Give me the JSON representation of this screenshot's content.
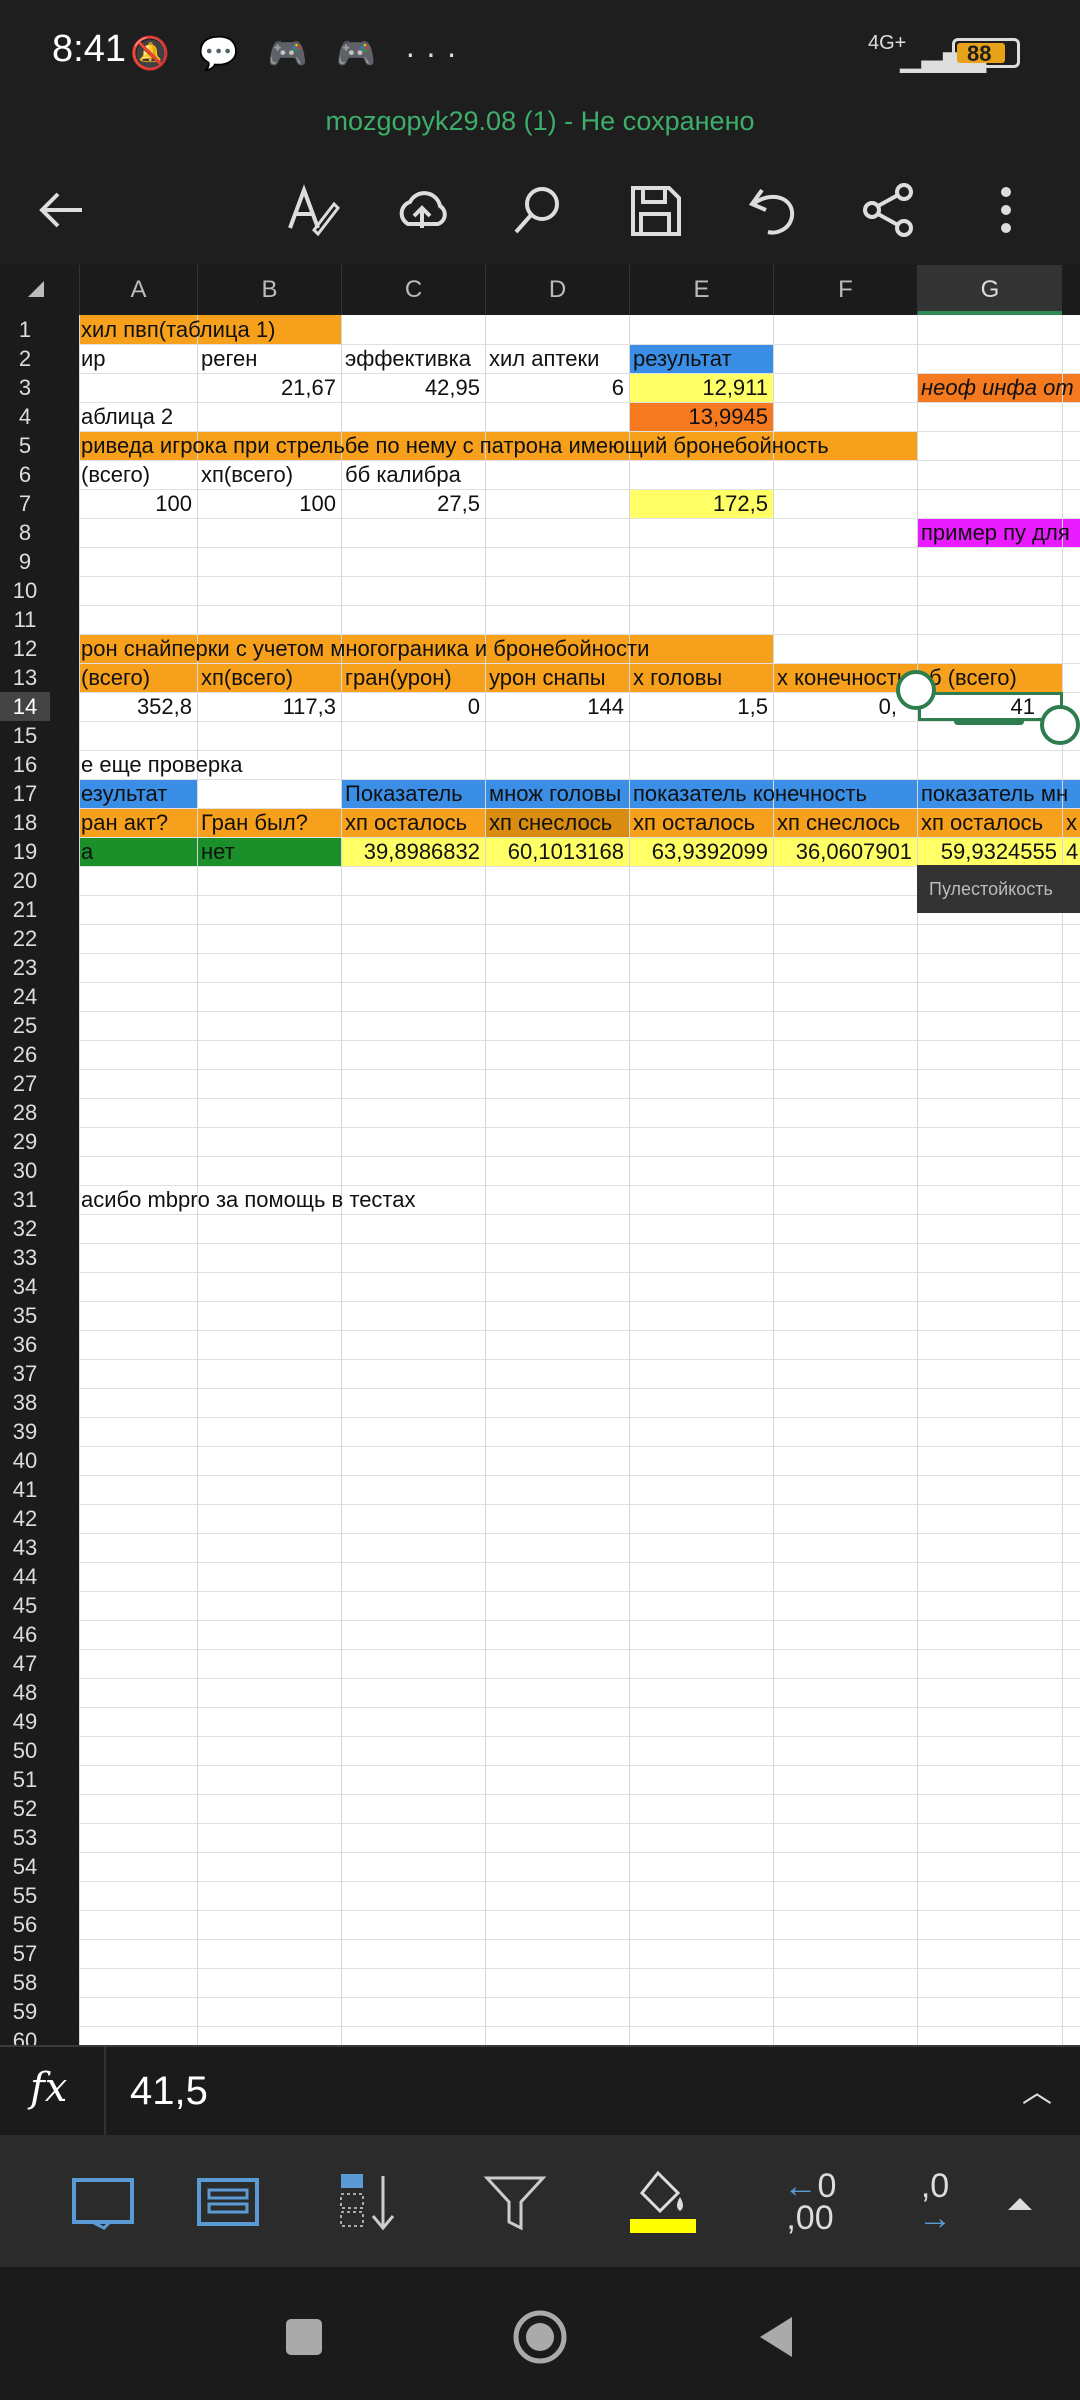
{
  "status": {
    "time": "8:41",
    "notif_icons": "🔕 💬 🎮 🎮 ···",
    "network": "4G+",
    "battery": "88"
  },
  "document": {
    "title": "mozgopyk29.08 (1) - Не сохранено"
  },
  "toolbar_icons": [
    "back-arrow-icon",
    "format-text-icon",
    "cloud-upload-icon",
    "search-icon",
    "save-icon",
    "undo-icon",
    "share-icon",
    "more-vert-icon"
  ],
  "columns": [
    "A",
    "B",
    "C",
    "D",
    "E",
    "F",
    "G"
  ],
  "rows": [
    "1",
    "2",
    "3",
    "4",
    "5",
    "6",
    "7",
    "8",
    "9",
    "10",
    "11",
    "12",
    "13",
    "14",
    "15",
    "16",
    "17",
    "18",
    "19",
    "20",
    "21",
    "22",
    "23",
    "24",
    "25",
    "26",
    "27",
    "28",
    "29",
    "30",
    "31",
    "32",
    "33",
    "34",
    "35",
    "36",
    "37",
    "38",
    "39",
    "40",
    "41",
    "42",
    "43",
    "44",
    "45",
    "46",
    "47",
    "48",
    "49",
    "50",
    "51",
    "52",
    "53",
    "54",
    "55",
    "56",
    "57",
    "58",
    "59",
    "60"
  ],
  "cells": {
    "r1_a": "хил пвп(таблица 1)",
    "r2_a": "ир",
    "r2_b": "реген",
    "r2_c": "эффективка",
    "r2_d": "хил аптеки",
    "r2_e": "результат",
    "r3_b": "21,67",
    "r3_c": "42,95",
    "r3_d": "6",
    "r3_e": "12,911",
    "r3_g": "неоф инфа от",
    "r4_a": "аблица 2",
    "r4_e": "13,9945",
    "r5_a": "риведа игрока при стрельбе по нему с патрона имеющий бронебойность",
    "r6_a": "(всего)",
    "r6_b": "хп(всего)",
    "r6_c": "бб калибра",
    "r7_a": "100",
    "r7_b": "100",
    "r7_c": "27,5",
    "r7_e": "172,5",
    "r8_g": "пример пу для",
    "r9_tooltip": "Пулестойкость",
    "r12_a": "рон снайперки с учетом многограника и бронебойности",
    "r13_a": "(всего)",
    "r13_b": "хп(всего)",
    "r13_c": "гран(урон)",
    "r13_d": "урон снапы",
    "r13_e": "x головы",
    "r13_f": "x конечности",
    "r13_g": "б (всего)",
    "r14_a": "352,8",
    "r14_b": "117,3",
    "r14_c": "0",
    "r14_d": "144",
    "r14_e": "1,5",
    "r14_f": "0,",
    "r14_g": "41",
    "r16_a": "е еще проверка",
    "r17_a": "езультат",
    "r17_c": "Показатель",
    "r17_d": "множ головы",
    "r17_e": "показатель конечность",
    "r17_g": "показатель мн",
    "r18_a": "ран акт?",
    "r18_b": "Гран был?",
    "r18_c": "хп осталось",
    "r18_d": "хп снеслось",
    "r18_e": "хп осталось",
    "r18_f": "хп снеслось",
    "r18_g": "хп осталось",
    "r18_h": "х",
    "r19_a": "а",
    "r19_b": "нет",
    "r19_c": "39,8986832",
    "r19_d": "60,1013168",
    "r19_e": "63,9392099",
    "r19_f": "36,0607901",
    "r19_g": "59,9324555",
    "r19_h": "4",
    "r31_a": "асибо mbpro за помощь в тестах"
  },
  "formula_bar": {
    "fx_label": "fx",
    "value": "41,5"
  },
  "bottom_tools": [
    "sheets-icon",
    "list-icon",
    "sort-icon",
    "filter-icon",
    "fill-color-icon",
    "decrease-decimal-icon",
    "increase-decimal-icon",
    "expand-up-icon"
  ],
  "decimal_labels": {
    "dec_top": "0",
    "dec_bottom": ",00",
    "inc_top": ",0",
    "inc_bottom": ""
  },
  "colors": {
    "orange": "#f7a01b",
    "blue": "#3a8ee6",
    "yellow": "#ffff66",
    "dark_orange": "#f4791f",
    "magenta": "#e81cff",
    "green": "#1a8f2a",
    "accent_green": "#2e7d4f",
    "title_green": "#3dae6a"
  }
}
